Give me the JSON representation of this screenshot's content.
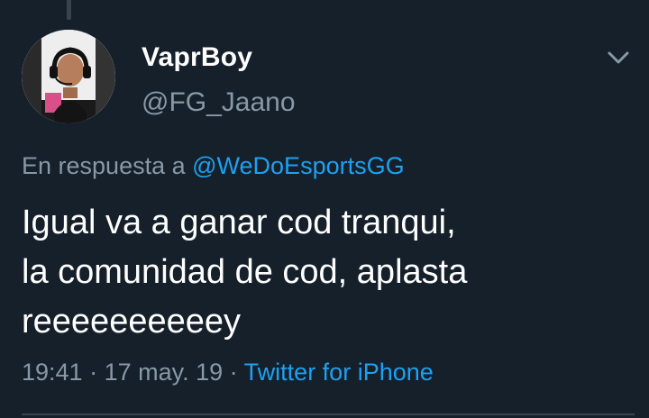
{
  "tweet": {
    "author": {
      "display_name": "VaprBoy",
      "handle": "@FG_Jaano",
      "avatar_icon": "profile-photo"
    },
    "reply_prefix": "En respuesta a ",
    "reply_to": "@WeDoEsportsGG",
    "text_lines": [
      "Igual va a ganar cod tranqui,",
      "la comunidad de cod, aplasta",
      "reeeeeeeeeey"
    ],
    "time": "19:41",
    "date": "17 may. 19",
    "source": "Twitter for iPhone",
    "separator": " · "
  },
  "icons": {
    "more": "chevron-down-icon"
  },
  "colors": {
    "background": "#15202b",
    "primary_text": "#ffffff",
    "secondary_text": "#8899a6",
    "link": "#1da1f2",
    "divider": "#38444d"
  }
}
